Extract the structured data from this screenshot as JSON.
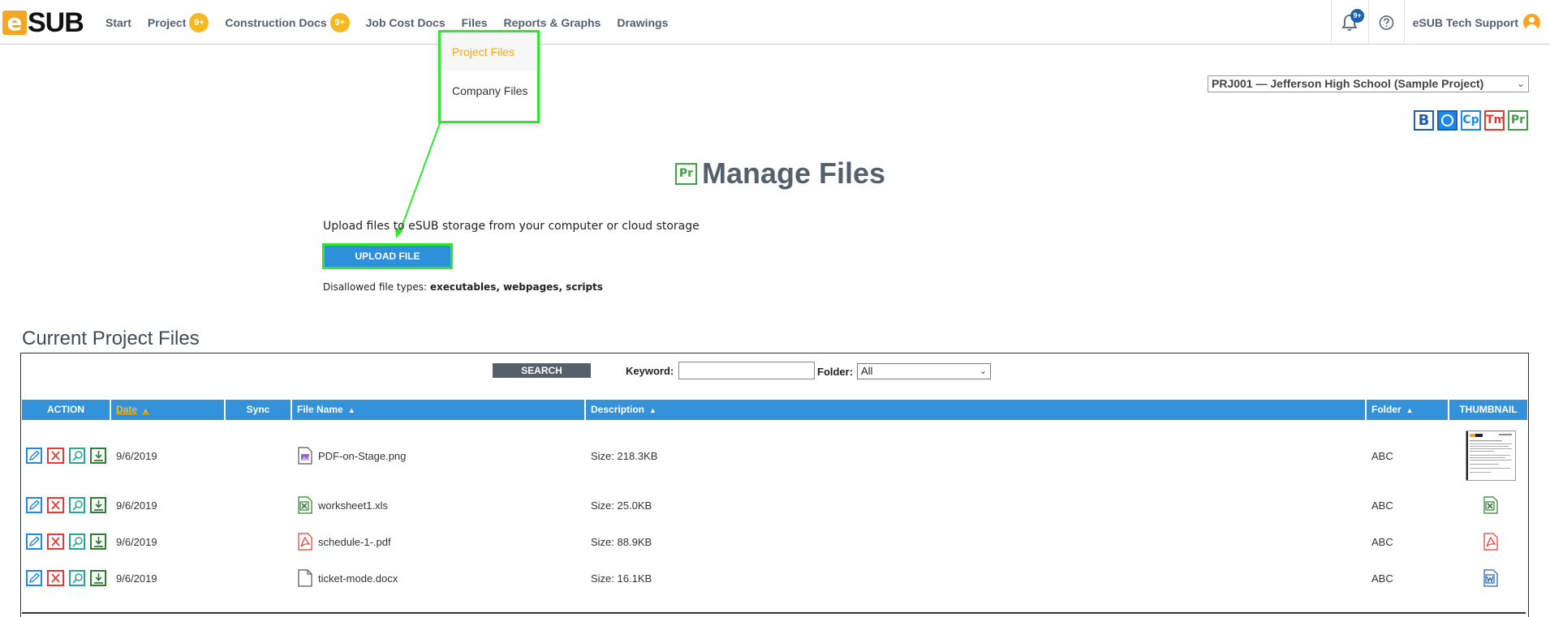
{
  "nav": {
    "logo_e": "e",
    "logo_text": "SUB",
    "items": [
      {
        "label": "Start",
        "badge": ""
      },
      {
        "label": "Project",
        "badge": "9+"
      },
      {
        "label": "Construction Docs",
        "badge": "9+"
      },
      {
        "label": "Job Cost Docs",
        "badge": ""
      },
      {
        "label": "Files",
        "badge": ""
      },
      {
        "label": "Reports & Graphs",
        "badge": ""
      },
      {
        "label": "Drawings",
        "badge": ""
      }
    ],
    "notification_badge": "9+",
    "user_name": "eSUB Tech Support"
  },
  "files_menu": {
    "items": [
      "Project Files",
      "Company Files"
    ]
  },
  "project_selector": {
    "value": "PRJ001 — Jefferson High School (Sample Project)"
  },
  "modules": [
    "B",
    "",
    "Cp",
    "Tm",
    "Pr"
  ],
  "page": {
    "icon_label": "Pr",
    "title": "Manage Files",
    "upload_text": "Upload files to eSUB storage from your computer or cloud storage",
    "upload_button": "UPLOAD FILE",
    "disallowed_prefix": "Disallowed file types:",
    "disallowed_types": "executables, webpages, scripts"
  },
  "files": {
    "section_title": "Current Project Files",
    "search_button": "SEARCH",
    "keyword_label": "Keyword:",
    "keyword_value": "",
    "folder_label": "Folder:",
    "folder_value": "All",
    "columns": [
      "ACTION",
      "Date",
      "Sync",
      "File Name",
      "Description",
      "Folder",
      "THUMBNAIL"
    ],
    "rows": [
      {
        "date": "9/6/2019",
        "sync": "",
        "file_name": "PDF-on-Stage.png",
        "description": "Size: 218.3KB",
        "folder": "ABC",
        "type": "image"
      },
      {
        "date": "9/6/2019",
        "sync": "",
        "file_name": "worksheet1.xls",
        "description": "Size: 25.0KB",
        "folder": "ABC",
        "type": "excel"
      },
      {
        "date": "9/6/2019",
        "sync": "",
        "file_name": "schedule-1-.pdf",
        "description": "Size: 88.9KB",
        "folder": "ABC",
        "type": "pdf"
      },
      {
        "date": "9/6/2019",
        "sync": "",
        "file_name": "ticket-mode.docx",
        "description": "Size: 16.1KB",
        "folder": "ABC",
        "type": "word"
      }
    ]
  },
  "colors": {
    "brand_orange": "#f5a623",
    "header_blue": "#3492db",
    "highlight_green": "#2ee82e"
  }
}
